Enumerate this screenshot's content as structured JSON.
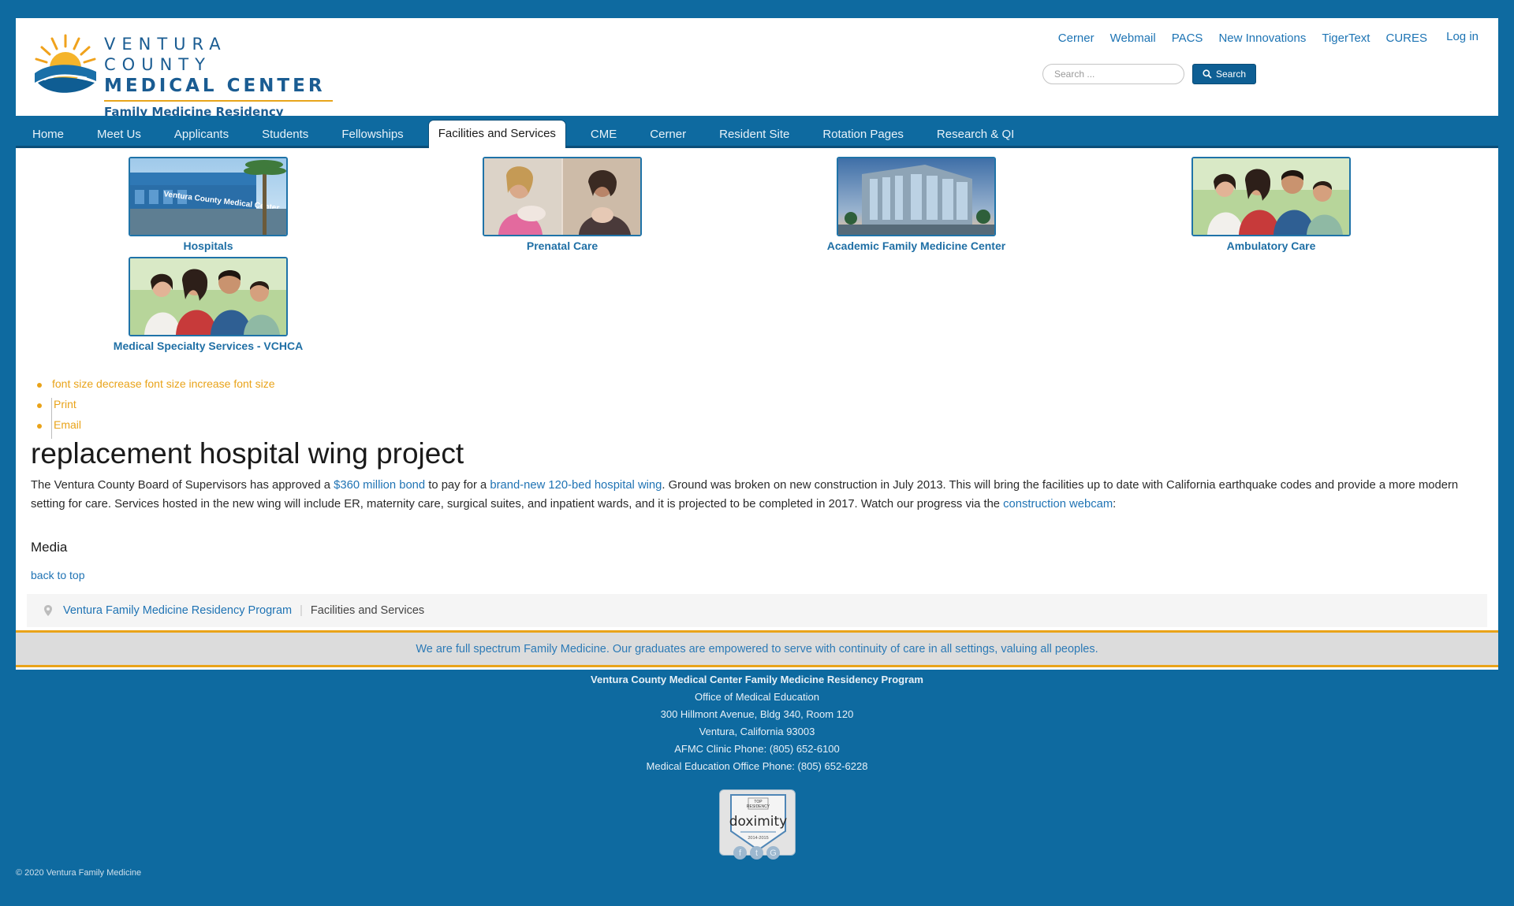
{
  "logo": {
    "line1": "VENTURA COUNTY",
    "line2": "MEDICAL CENTER",
    "line3": "Family Medicine Residency Program"
  },
  "toplinks": [
    "Cerner",
    "Webmail",
    "PACS",
    "New Innovations",
    "TigerText",
    "CURES"
  ],
  "login": "Log in",
  "search": {
    "placeholder": "Search ...",
    "button": "Search"
  },
  "nav": {
    "items": [
      "Home",
      "Meet Us",
      "Applicants",
      "Students",
      "Fellowships",
      "Facilities and Services",
      "CME",
      "Cerner",
      "Resident Site",
      "Rotation Pages",
      "Research & QI"
    ],
    "active": "Facilities and Services"
  },
  "services": [
    {
      "label": "Hospitals",
      "sign": "Ventura County Medical Center"
    },
    {
      "label": "Prenatal Care"
    },
    {
      "label": "Academic Family Medicine Center"
    },
    {
      "label": "Ambulatory Care"
    },
    {
      "label": "Medical Specialty Services - VCHCA"
    }
  ],
  "tools": {
    "font": "font size decrease font size increase font size",
    "print": "Print",
    "email": "Email"
  },
  "article": {
    "title": "replacement hospital wing project",
    "p1": "The Ventura County Board of Supervisors has approved a ",
    "link1": "$360 million bond",
    "p2": " to pay for a ",
    "link2": "brand-new 120-bed hospital wing",
    "p3": ". Ground was broken on new construction in July 2013. This will bring the facilities up to date with California earthquake codes and provide a more modern setting for care. Services hosted in the new wing will include ER, maternity care, surgical suites, and inpatient wards, and it is projected to be completed in 2017. Watch our progress via the ",
    "link3": "construction webcam",
    "p4": ":",
    "media_heading": "Media",
    "back_to_top": "back to top"
  },
  "breadcrumb": {
    "home": "Ventura Family Medicine Residency Program",
    "current": "Facilities and Services"
  },
  "motto": "We are full spectrum Family Medicine. Our graduates are empowered to serve with continuity of care in all settings, valuing all peoples.",
  "footer": {
    "lines": [
      "Ventura County Medical Center Family Medicine Residency Program",
      "Office of Medical Education",
      "300 Hillmont Avenue, Bldg 340, Room 120",
      "Ventura, California 93003",
      "AFMC Clinic Phone: (805) 652-6100",
      "Medical Education Office Phone: (805) 652-6228"
    ],
    "badge": {
      "top": "TOP",
      "residency": "RESIDENCY",
      "brand": "doximity",
      "years": "2014-2015"
    },
    "social": [
      "f",
      "t",
      "G"
    ],
    "copyright": "© 2020 Ventura Family Medicine"
  },
  "colors": {
    "brand_blue": "#0e6aa0",
    "accent_gold": "#e9a319",
    "link_blue": "#1f73b4"
  }
}
